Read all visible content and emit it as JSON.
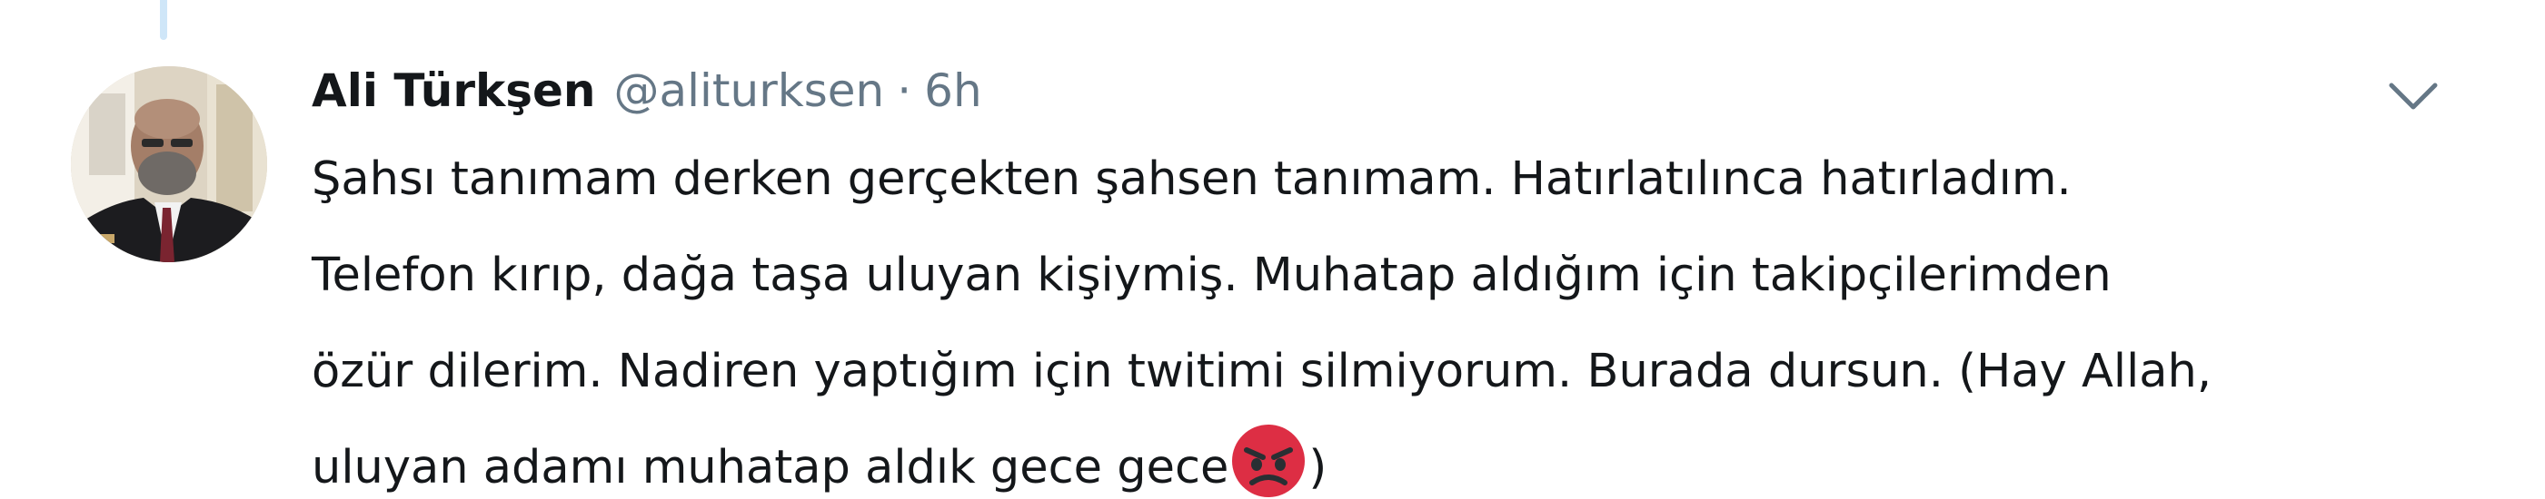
{
  "tweet": {
    "author_name": "Ali Türkşen",
    "author_handle": "@aliturksen",
    "separator": "·",
    "timestamp": "6h",
    "avatar_icon": "profile-photo",
    "menu_icon": "chevron-down-icon",
    "text_lines": [
      "Şahsı tanımam derken gerçekten şahsen tanımam. Hatırlatılınca hatırladım.",
      "Telefon kırıp, dağa taşa uluyan kişiymiş. Muhatap aldığım için takipçilerimden",
      "özür dilerim. Nadiren yaptığım için twitimi silmiyorum. Burada dursun. (Hay Allah,",
      "uluyan adamı muhatap aldık gece gece"
    ],
    "text_after_emoji": ")",
    "emoji_icon": "angry-face-emoji",
    "colors": {
      "name": "#14171a",
      "secondary": "#657786",
      "thread_line": "#cfe6f8",
      "emoji": "#dd2e44"
    }
  }
}
